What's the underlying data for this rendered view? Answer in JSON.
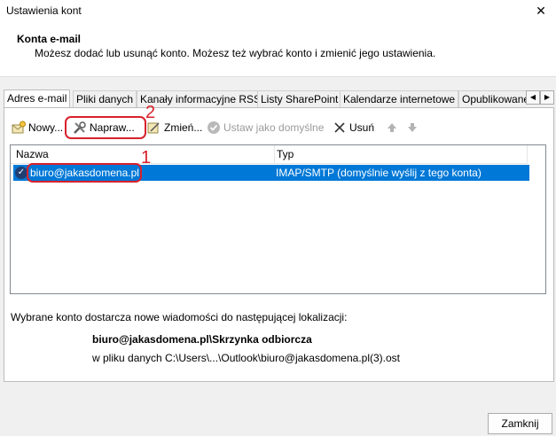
{
  "window": {
    "title": "Ustawienia kont",
    "close_glyph": "✕"
  },
  "header": {
    "title": "Konta e-mail",
    "description": "Możesz dodać lub usunąć konto. Możesz też wybrać konto i zmienić jego ustawienia."
  },
  "tabs": [
    {
      "label": "Adres e-mail",
      "active": true
    },
    {
      "label": "Pliki danych"
    },
    {
      "label": "Kanały informacyjne RSS"
    },
    {
      "label": "Listy SharePoint"
    },
    {
      "label": "Kalendarze internetowe"
    },
    {
      "label": "Opublikowane kalendarze"
    }
  ],
  "toolbar": {
    "new_label": "Nowy...",
    "repair_label": "Napraw...",
    "change_label": "Zmień...",
    "set_default_label": "Ustaw jako domyślne",
    "remove_label": "Usuń"
  },
  "annotations": {
    "repair_number": "2",
    "account_number": "1"
  },
  "accounts_table": {
    "columns": [
      "Nazwa",
      "Typ"
    ],
    "rows": [
      {
        "name": "biuro@jakasdomena.pl",
        "type": "IMAP/SMTP (domyślnie wyślij z tego konta)",
        "selected": true
      }
    ]
  },
  "delivery": {
    "description": "Wybrane konto dostarcza nowe wiadomości do następującej lokalizacji:",
    "location": "biuro@jakasdomena.pl\\Skrzynka odbiorcza",
    "data_file": "w pliku danych C:\\Users\\...\\Outlook\\biuro@jakasdomena.pl(3).ost"
  },
  "footer": {
    "close_label": "Zamknij"
  },
  "colors": {
    "selection": "#0078d7",
    "annotation": "#d8212b"
  }
}
